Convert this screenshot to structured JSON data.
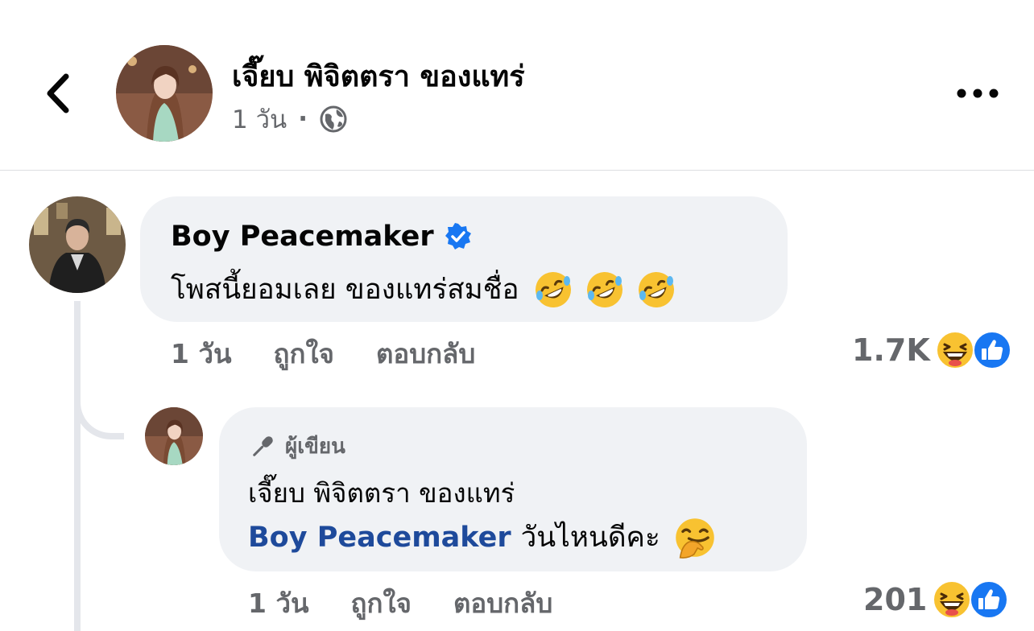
{
  "header": {
    "author": "เจี๊ยบ พิจิตตรา ของแทร่",
    "time": "1 วัน"
  },
  "comment1": {
    "author": "Boy Peacemaker",
    "text": "โพสนี้ยอมเลย ของแทร่สมชื่อ",
    "time": "1 วัน",
    "like": "ถูกใจ",
    "reply": "ตอบกลับ",
    "reaction_count": "1.7K"
  },
  "reply1": {
    "badge": "ผู้เขียน",
    "author": "เจี๊ยบ พิจิตตรา ของแทร่",
    "mention": "Boy Peacemaker",
    "text": "วันไหนดีคะ",
    "time": "1 วัน",
    "like": "ถูกใจ",
    "reply": "ตอบกลับ",
    "reaction_count": "201"
  },
  "colors": {
    "facebook_blue": "#1877f2",
    "secondary_text": "#65676b",
    "bubble": "#f0f2f5",
    "mention": "#1e4a9b"
  }
}
